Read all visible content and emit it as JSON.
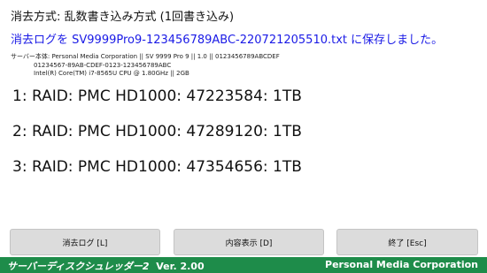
{
  "erase_method": "消去方式: 乱数書き込み方式 (1回書き込み)",
  "log_saved_message": "消去ログを SV9999Pro9-123456789ABC-220721205510.txt に保存しました。",
  "system_info": {
    "line1": "サーバー本体: Personal Media Corporation || SV 9999 Pro 9 || 1.0 || 0123456789ABCDEF",
    "line2": "01234567-89AB-CDEF-0123-123456789ABC",
    "line3": "Intel(R) Core(TM) i7-8565U CPU @ 1.80GHz || 2GB"
  },
  "disks": [
    "1: RAID: PMC HD1000: 47223584: 1TB",
    "2: RAID: PMC HD1000: 47289120: 1TB",
    "3: RAID: PMC HD1000: 47354656: 1TB"
  ],
  "buttons": {
    "erase_log": "消去ログ [L]",
    "show_contents": "内容表示 [D]",
    "exit": "終了 [Esc]"
  },
  "footer": {
    "app_name": "サーバーディスクシュレッダー2",
    "version": "Ver. 2.00",
    "company": "Personal Media Corporation"
  },
  "colors": {
    "footer_bg": "#1e8c4a",
    "message_text": "#1a1ae6",
    "button_bg": "#dcdcdc"
  }
}
